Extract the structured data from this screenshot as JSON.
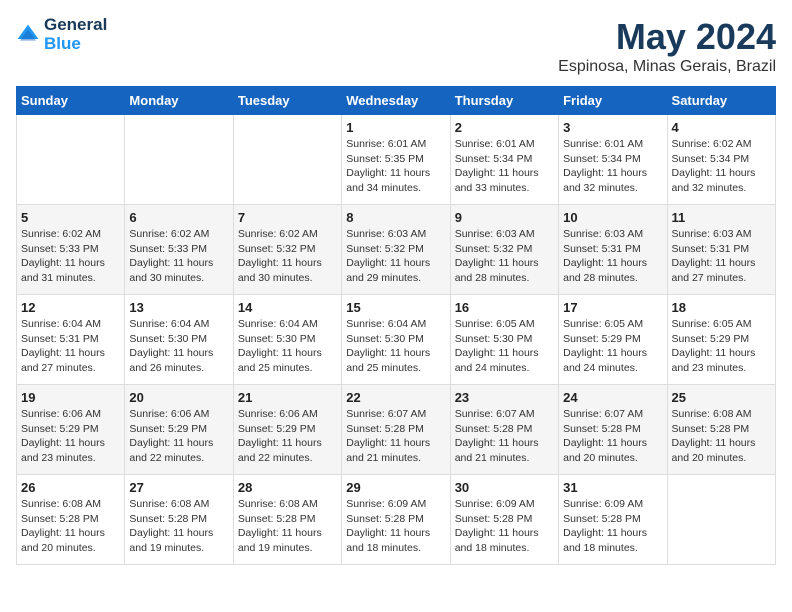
{
  "logo": {
    "line1": "General",
    "line2": "Blue"
  },
  "title": "May 2024",
  "location": "Espinosa, Minas Gerais, Brazil",
  "weekdays": [
    "Sunday",
    "Monday",
    "Tuesday",
    "Wednesday",
    "Thursday",
    "Friday",
    "Saturday"
  ],
  "weeks": [
    [
      {
        "day": "",
        "info": ""
      },
      {
        "day": "",
        "info": ""
      },
      {
        "day": "",
        "info": ""
      },
      {
        "day": "1",
        "info": "Sunrise: 6:01 AM\nSunset: 5:35 PM\nDaylight: 11 hours\nand 34 minutes."
      },
      {
        "day": "2",
        "info": "Sunrise: 6:01 AM\nSunset: 5:34 PM\nDaylight: 11 hours\nand 33 minutes."
      },
      {
        "day": "3",
        "info": "Sunrise: 6:01 AM\nSunset: 5:34 PM\nDaylight: 11 hours\nand 32 minutes."
      },
      {
        "day": "4",
        "info": "Sunrise: 6:02 AM\nSunset: 5:34 PM\nDaylight: 11 hours\nand 32 minutes."
      }
    ],
    [
      {
        "day": "5",
        "info": "Sunrise: 6:02 AM\nSunset: 5:33 PM\nDaylight: 11 hours\nand 31 minutes."
      },
      {
        "day": "6",
        "info": "Sunrise: 6:02 AM\nSunset: 5:33 PM\nDaylight: 11 hours\nand 30 minutes."
      },
      {
        "day": "7",
        "info": "Sunrise: 6:02 AM\nSunset: 5:32 PM\nDaylight: 11 hours\nand 30 minutes."
      },
      {
        "day": "8",
        "info": "Sunrise: 6:03 AM\nSunset: 5:32 PM\nDaylight: 11 hours\nand 29 minutes."
      },
      {
        "day": "9",
        "info": "Sunrise: 6:03 AM\nSunset: 5:32 PM\nDaylight: 11 hours\nand 28 minutes."
      },
      {
        "day": "10",
        "info": "Sunrise: 6:03 AM\nSunset: 5:31 PM\nDaylight: 11 hours\nand 28 minutes."
      },
      {
        "day": "11",
        "info": "Sunrise: 6:03 AM\nSunset: 5:31 PM\nDaylight: 11 hours\nand 27 minutes."
      }
    ],
    [
      {
        "day": "12",
        "info": "Sunrise: 6:04 AM\nSunset: 5:31 PM\nDaylight: 11 hours\nand 27 minutes."
      },
      {
        "day": "13",
        "info": "Sunrise: 6:04 AM\nSunset: 5:30 PM\nDaylight: 11 hours\nand 26 minutes."
      },
      {
        "day": "14",
        "info": "Sunrise: 6:04 AM\nSunset: 5:30 PM\nDaylight: 11 hours\nand 25 minutes."
      },
      {
        "day": "15",
        "info": "Sunrise: 6:04 AM\nSunset: 5:30 PM\nDaylight: 11 hours\nand 25 minutes."
      },
      {
        "day": "16",
        "info": "Sunrise: 6:05 AM\nSunset: 5:30 PM\nDaylight: 11 hours\nand 24 minutes."
      },
      {
        "day": "17",
        "info": "Sunrise: 6:05 AM\nSunset: 5:29 PM\nDaylight: 11 hours\nand 24 minutes."
      },
      {
        "day": "18",
        "info": "Sunrise: 6:05 AM\nSunset: 5:29 PM\nDaylight: 11 hours\nand 23 minutes."
      }
    ],
    [
      {
        "day": "19",
        "info": "Sunrise: 6:06 AM\nSunset: 5:29 PM\nDaylight: 11 hours\nand 23 minutes."
      },
      {
        "day": "20",
        "info": "Sunrise: 6:06 AM\nSunset: 5:29 PM\nDaylight: 11 hours\nand 22 minutes."
      },
      {
        "day": "21",
        "info": "Sunrise: 6:06 AM\nSunset: 5:29 PM\nDaylight: 11 hours\nand 22 minutes."
      },
      {
        "day": "22",
        "info": "Sunrise: 6:07 AM\nSunset: 5:28 PM\nDaylight: 11 hours\nand 21 minutes."
      },
      {
        "day": "23",
        "info": "Sunrise: 6:07 AM\nSunset: 5:28 PM\nDaylight: 11 hours\nand 21 minutes."
      },
      {
        "day": "24",
        "info": "Sunrise: 6:07 AM\nSunset: 5:28 PM\nDaylight: 11 hours\nand 20 minutes."
      },
      {
        "day": "25",
        "info": "Sunrise: 6:08 AM\nSunset: 5:28 PM\nDaylight: 11 hours\nand 20 minutes."
      }
    ],
    [
      {
        "day": "26",
        "info": "Sunrise: 6:08 AM\nSunset: 5:28 PM\nDaylight: 11 hours\nand 20 minutes."
      },
      {
        "day": "27",
        "info": "Sunrise: 6:08 AM\nSunset: 5:28 PM\nDaylight: 11 hours\nand 19 minutes."
      },
      {
        "day": "28",
        "info": "Sunrise: 6:08 AM\nSunset: 5:28 PM\nDaylight: 11 hours\nand 19 minutes."
      },
      {
        "day": "29",
        "info": "Sunrise: 6:09 AM\nSunset: 5:28 PM\nDaylight: 11 hours\nand 18 minutes."
      },
      {
        "day": "30",
        "info": "Sunrise: 6:09 AM\nSunset: 5:28 PM\nDaylight: 11 hours\nand 18 minutes."
      },
      {
        "day": "31",
        "info": "Sunrise: 6:09 AM\nSunset: 5:28 PM\nDaylight: 11 hours\nand 18 minutes."
      },
      {
        "day": "",
        "info": ""
      }
    ]
  ]
}
